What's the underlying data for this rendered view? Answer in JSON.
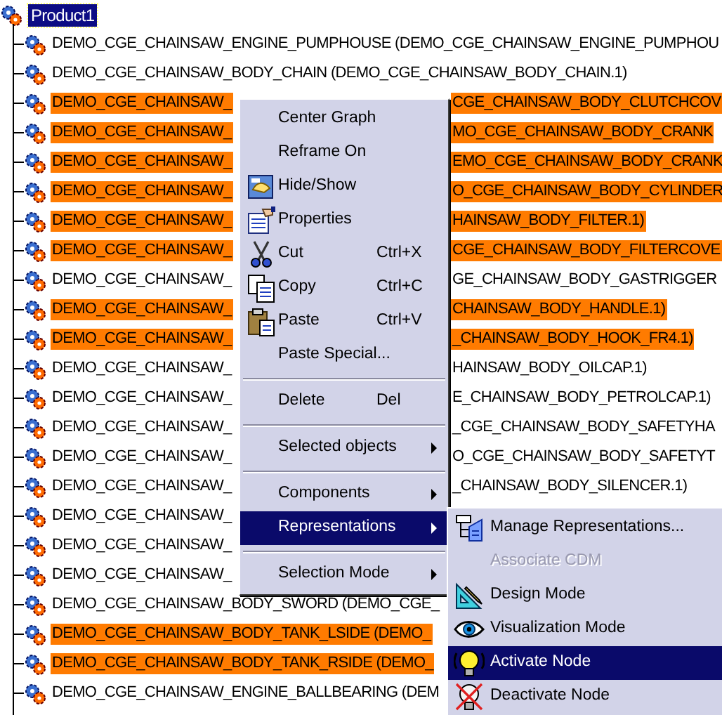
{
  "tree": {
    "root": {
      "label": "Product1",
      "selected": true,
      "children": [
        {
          "text": "DEMO_CGE_CHAINSAW_ENGINE_PUMPHOUSE (DEMO_CGE_CHAINSAW_ENGINE_PUMPHOU",
          "selected": false
        },
        {
          "text": "DEMO_CGE_CHAINSAW_BODY_CHAIN (DEMO_CGE_CHAINSAW_BODY_CHAIN.1)",
          "selected": false
        },
        {
          "text": "DEMO_CGE_CHAINSAW_",
          "text_after_menu": "CGE_CHAINSAW_BODY_CLUTCHCOV",
          "selected": true
        },
        {
          "text": "DEMO_CGE_CHAINSAW_",
          "text_after_menu": "MO_CGE_CHAINSAW_BODY_CRANK",
          "selected": true
        },
        {
          "text": "DEMO_CGE_CHAINSAW_",
          "text_after_menu": "EMO_CGE_CHAINSAW_BODY_CRANK",
          "selected": true
        },
        {
          "text": "DEMO_CGE_CHAINSAW_",
          "text_after_menu": "O_CGE_CHAINSAW_BODY_CYLINDER",
          "selected": true
        },
        {
          "text": "DEMO_CGE_CHAINSAW_",
          "text_after_menu": "HAINSAW_BODY_FILTER.1)",
          "selected": true
        },
        {
          "text": "DEMO_CGE_CHAINSAW_",
          "text_after_menu": "CGE_CHAINSAW_BODY_FILTERCOVE",
          "selected": true
        },
        {
          "text": "DEMO_CGE_CHAINSAW_",
          "text_after_menu": "GE_CHAINSAW_BODY_GASTRIGGER",
          "selected": false
        },
        {
          "text": "DEMO_CGE_CHAINSAW_",
          "text_after_menu": "CHAINSAW_BODY_HANDLE.1)",
          "selected": true
        },
        {
          "text": "DEMO_CGE_CHAINSAW_",
          "text_after_menu": "_CHAINSAW_BODY_HOOK_FR4.1)",
          "selected": true
        },
        {
          "text": "DEMO_CGE_CHAINSAW_",
          "text_after_menu": "HAINSAW_BODY_OILCAP.1)",
          "selected": false
        },
        {
          "text": "DEMO_CGE_CHAINSAW_",
          "text_after_menu": "E_CHAINSAW_BODY_PETROLCAP.1)",
          "selected": false
        },
        {
          "text": "DEMO_CGE_CHAINSAW_",
          "text_after_menu": "_CGE_CHAINSAW_BODY_SAFETYHA",
          "selected": false
        },
        {
          "text": "DEMO_CGE_CHAINSAW_",
          "text_after_menu": "O_CGE_CHAINSAW_BODY_SAFETYT",
          "selected": false
        },
        {
          "text": "DEMO_CGE_CHAINSAW_",
          "text_after_menu": "_CHAINSAW_BODY_SILENCER.1)",
          "selected": false
        },
        {
          "text": "DEMO_CGE_CHAINSAW_",
          "selected": false
        },
        {
          "text": "DEMO_CGE_CHAINSAW_",
          "selected": false
        },
        {
          "text": "DEMO_CGE_CHAINSAW_",
          "selected": false
        },
        {
          "text": "DEMO_CGE_CHAINSAW_BODY_SWORD (DEMO_CGE_",
          "selected": false
        },
        {
          "text": "DEMO_CGE_CHAINSAW_BODY_TANK_LSIDE (DEMO_",
          "selected": true
        },
        {
          "text": "DEMO_CGE_CHAINSAW_BODY_TANK_RSIDE (DEMO_",
          "selected": true
        },
        {
          "text": "DEMO_CGE_CHAINSAW_ENGINE_BALLBEARING (DEM",
          "selected": false
        }
      ]
    }
  },
  "context_menu": {
    "items": [
      {
        "kind": "item",
        "label": "Center Graph",
        "highlighted": false
      },
      {
        "kind": "item",
        "label": "Reframe On",
        "highlighted": false
      },
      {
        "kind": "item",
        "label": "Hide/Show",
        "highlighted": false
      },
      {
        "kind": "item",
        "label": "Properties",
        "highlighted": false
      },
      {
        "kind": "item",
        "label": "Cut",
        "shortcut": "Ctrl+X",
        "highlighted": false
      },
      {
        "kind": "item",
        "label": "Copy",
        "shortcut": "Ctrl+C",
        "highlighted": false
      },
      {
        "kind": "item",
        "label": "Paste",
        "shortcut": "Ctrl+V",
        "highlighted": false
      },
      {
        "kind": "item",
        "label": "Paste Special...",
        "highlighted": false
      },
      {
        "kind": "separator"
      },
      {
        "kind": "item",
        "label": "Delete",
        "shortcut": "Del",
        "highlighted": false
      },
      {
        "kind": "separator"
      },
      {
        "kind": "submenu",
        "label": "Selected objects",
        "highlighted": false
      },
      {
        "kind": "separator"
      },
      {
        "kind": "submenu",
        "label": "Components",
        "highlighted": false
      },
      {
        "kind": "submenu",
        "label": "Representations",
        "highlighted": true
      },
      {
        "kind": "separator"
      },
      {
        "kind": "submenu",
        "label": "Selection Mode",
        "highlighted": false
      }
    ]
  },
  "submenu": {
    "items": [
      {
        "label": "Manage Representations...",
        "disabled": false,
        "highlighted": false
      },
      {
        "label": "Associate CDM",
        "disabled": true,
        "highlighted": false
      },
      {
        "label": "Design Mode",
        "disabled": false,
        "highlighted": false
      },
      {
        "label": "Visualization Mode",
        "disabled": false,
        "highlighted": false
      },
      {
        "label": "Activate Node",
        "disabled": false,
        "highlighted": true
      },
      {
        "label": "Deactivate Node",
        "disabled": false,
        "highlighted": false
      }
    ]
  }
}
